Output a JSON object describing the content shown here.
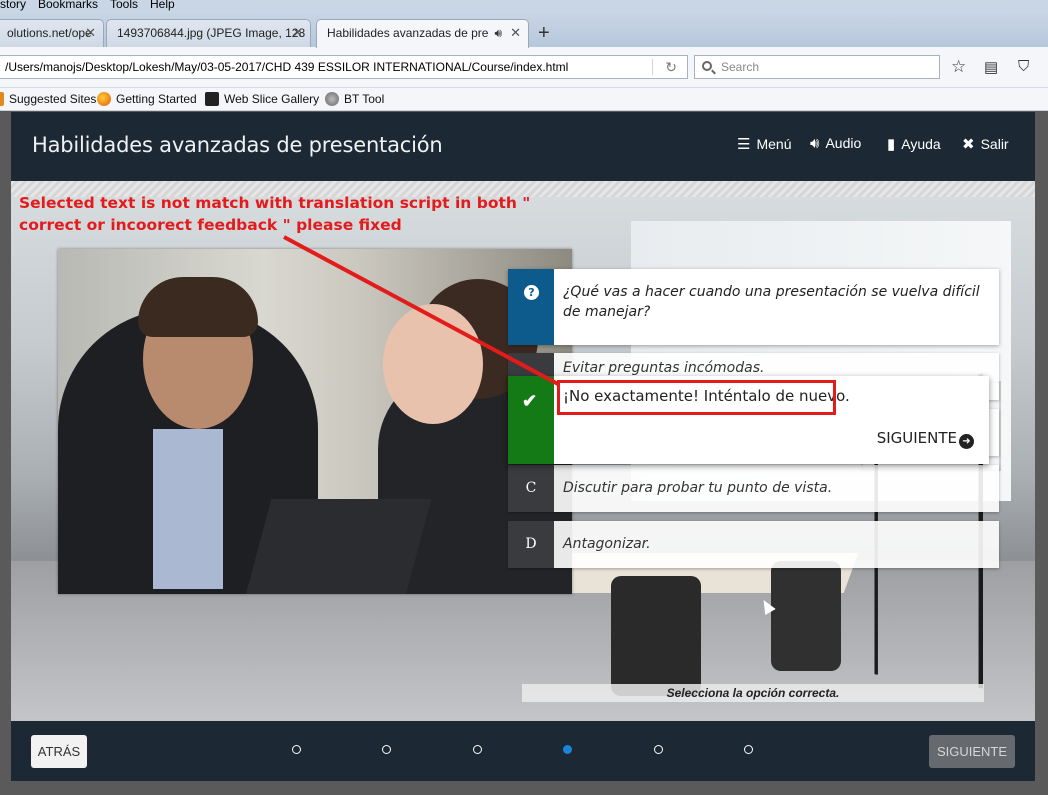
{
  "browser": {
    "menu": [
      "story",
      "Bookmarks",
      "Tools",
      "Help"
    ],
    "tabs": [
      {
        "label": "olutions.net/ope"
      },
      {
        "label": "1493706844.jpg (JPEG Image, 128"
      },
      {
        "label": "Habilidades avanzadas de pre"
      }
    ],
    "url": "/Users/manojs/Desktop/Lokesh/May/03-05-2017/CHD 439 ESSILOR INTERNATIONAL/Course/index.html",
    "search_placeholder": "Search",
    "bookmarks": [
      "Suggested Sites",
      "Getting Started",
      "Web Slice Gallery",
      "BT Tool"
    ]
  },
  "course": {
    "title": "Habilidades avanzadas de presentación",
    "header_buttons": {
      "menu": "Menú",
      "audio": "Audio",
      "help": "Ayuda",
      "exit": "Salir"
    },
    "question": "¿Qué vas a hacer cuando una presentación se vuelva difícil de manejar?",
    "options": [
      {
        "letter": "",
        "text": "Evitar preguntas incómodas."
      },
      {
        "letter": "",
        "text": ""
      },
      {
        "letter": "C",
        "text": "Discutir para probar tu punto de vista."
      },
      {
        "letter": "D",
        "text": "Antagonizar."
      }
    ],
    "feedback": {
      "text": "¡No exactamente! Inténtalo de nuevo.",
      "next": "SIGUIENTE"
    },
    "instruction": "Selecciona la opción correcta.",
    "footer": {
      "back": "ATRÁS",
      "next": "SIGUIENTE",
      "pages": 6,
      "current_page": 4
    }
  },
  "annotation": {
    "text": "Selected text is not match with translation script in both \" correct or incoorect feedback \" please fixed",
    "color": "#e31b1b"
  },
  "colors": {
    "question_badge": "#0d5b8c",
    "correct_badge": "#137a15",
    "active_dot": "#1a86d9"
  }
}
